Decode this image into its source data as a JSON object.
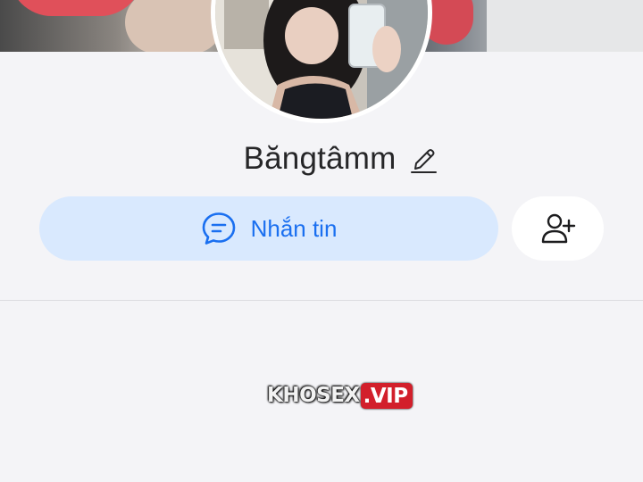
{
  "profile": {
    "name": "Băngtâmm"
  },
  "actions": {
    "message_label": "Nhắn tin"
  },
  "icons": {
    "edit": "pencil-icon",
    "message": "chat-bubble-icon",
    "add_friend": "add-user-icon"
  },
  "watermark": {
    "part1": "KHOSEX",
    "part2": ".VIP"
  },
  "colors": {
    "accent": "#1a6ff0",
    "message_button_bg": "#d9e9fe",
    "page_bg": "#f4f4f7",
    "watermark_red": "#d21f2b"
  }
}
